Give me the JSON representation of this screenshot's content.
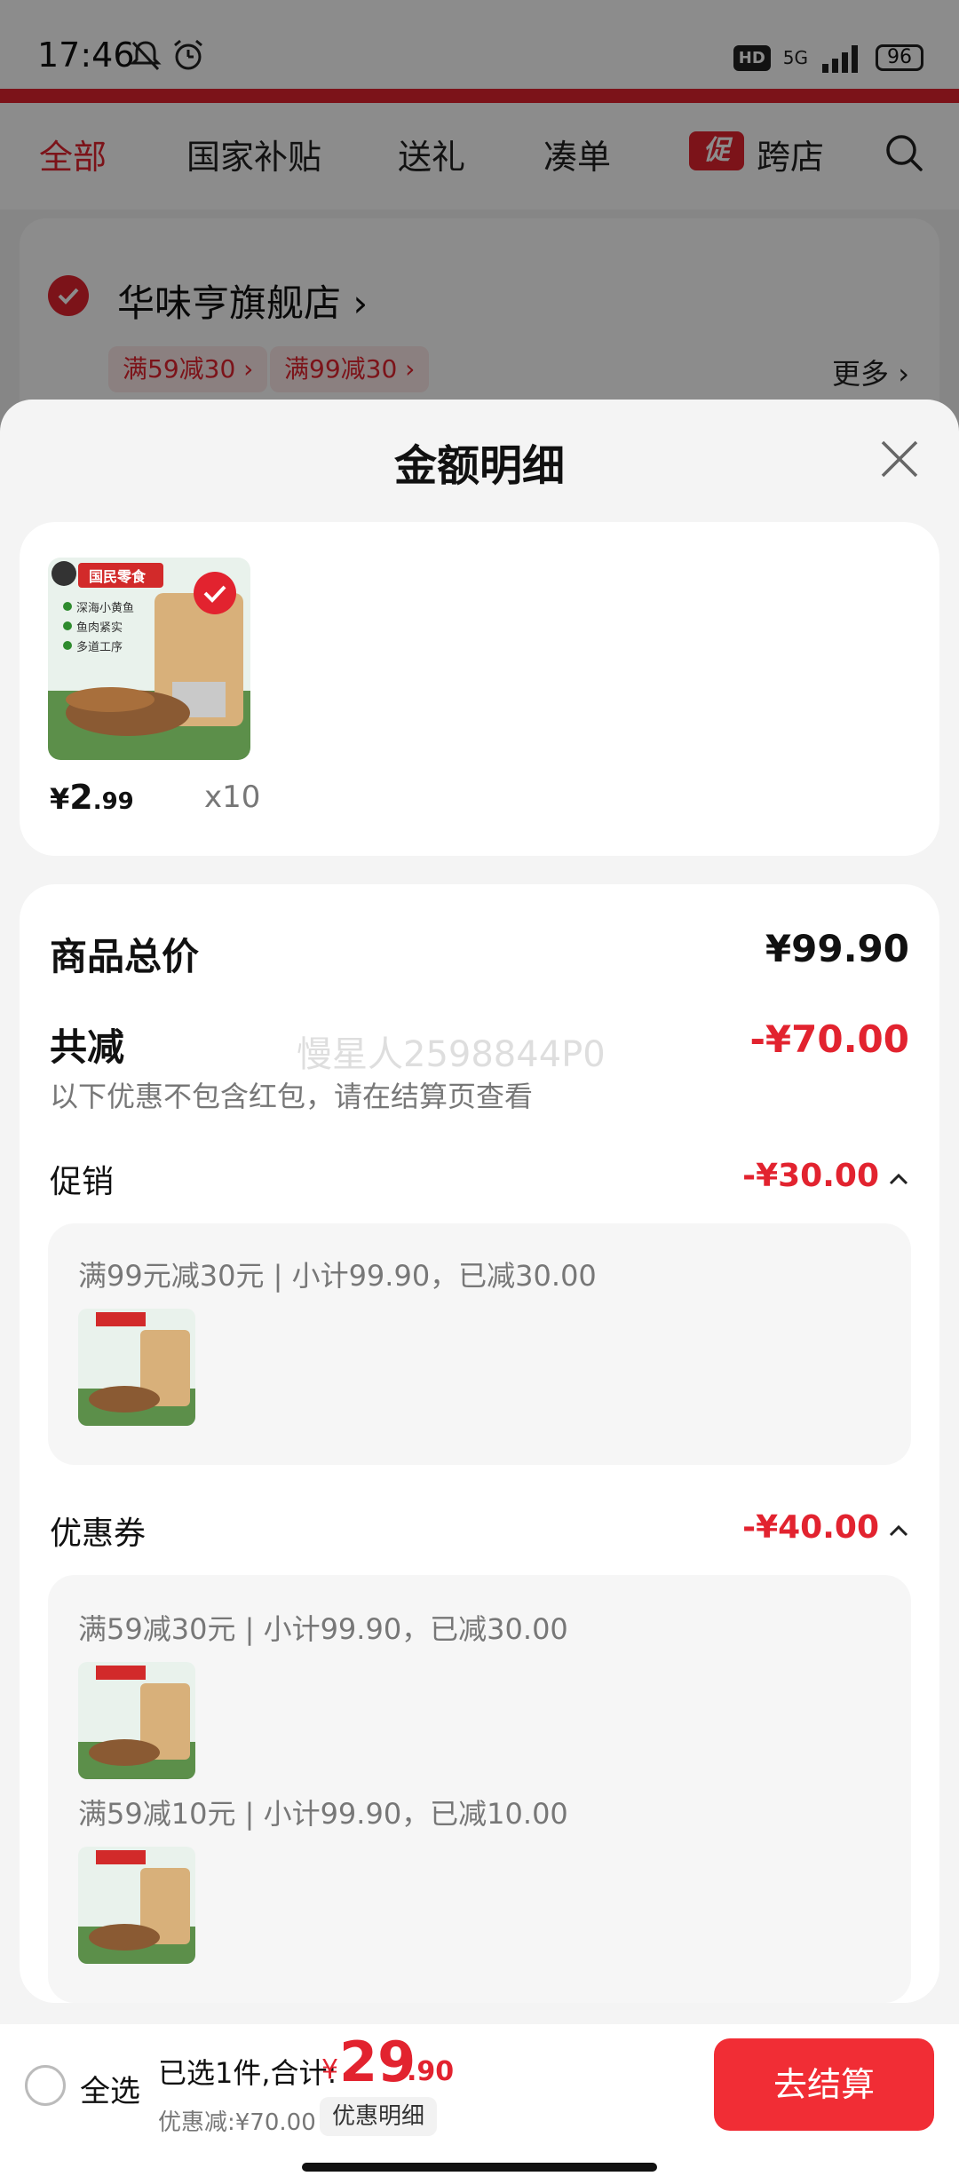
{
  "status_bar": {
    "time": "17:46",
    "hd": "HD",
    "network": "5G",
    "battery": "96"
  },
  "categories": [
    {
      "label": "全部"
    },
    {
      "label": "国家补贴"
    },
    {
      "label": "送礼"
    },
    {
      "label": "凑单"
    },
    {
      "label": "跨店"
    }
  ],
  "promo_tag": "促",
  "store": {
    "name": "华味亨旗舰店 ›",
    "coupons": [
      "满59减30 ›",
      "满99减30 ›"
    ],
    "more": "更多 ›"
  },
  "sheet": {
    "title": "金额明细",
    "product": {
      "price_yen": "¥",
      "price_int": "2",
      "price_dec": ".99",
      "quantity": "x10",
      "image_brand_text": "国民零食",
      "image_bullets": [
        "深海小黄鱼",
        "鱼肉紧实",
        "多道工序"
      ]
    },
    "total_price": {
      "label": "商品总价",
      "value": "¥99.90"
    },
    "total_discount": {
      "label": "共减",
      "value": "-¥70.00"
    },
    "note": "以下优惠不包含红包，请在结算页查看",
    "watermark": "慢星人2598844P0",
    "promotion": {
      "label": "促销",
      "value": "-¥30.00",
      "items": [
        {
          "text": "满99元减30元 | 小计99.90，已减30.00"
        }
      ]
    },
    "coupon": {
      "label": "优惠券",
      "value": "-¥40.00",
      "items": [
        {
          "text": "满59减30元 | 小计99.90，已减30.00"
        },
        {
          "text": "满59减10元 | 小计99.90，已减10.00"
        }
      ]
    }
  },
  "bottom_bar": {
    "select_all": "全选",
    "selected_total": "已选1件,合计:",
    "total_yen": "¥",
    "total_int": "29",
    "total_dec": ".90",
    "discount": "优惠减:¥70.00",
    "discount_detail": "优惠明细",
    "checkout": "去结算"
  },
  "colors": {
    "accent": "#e2232f",
    "checkout": "#f12d35"
  }
}
